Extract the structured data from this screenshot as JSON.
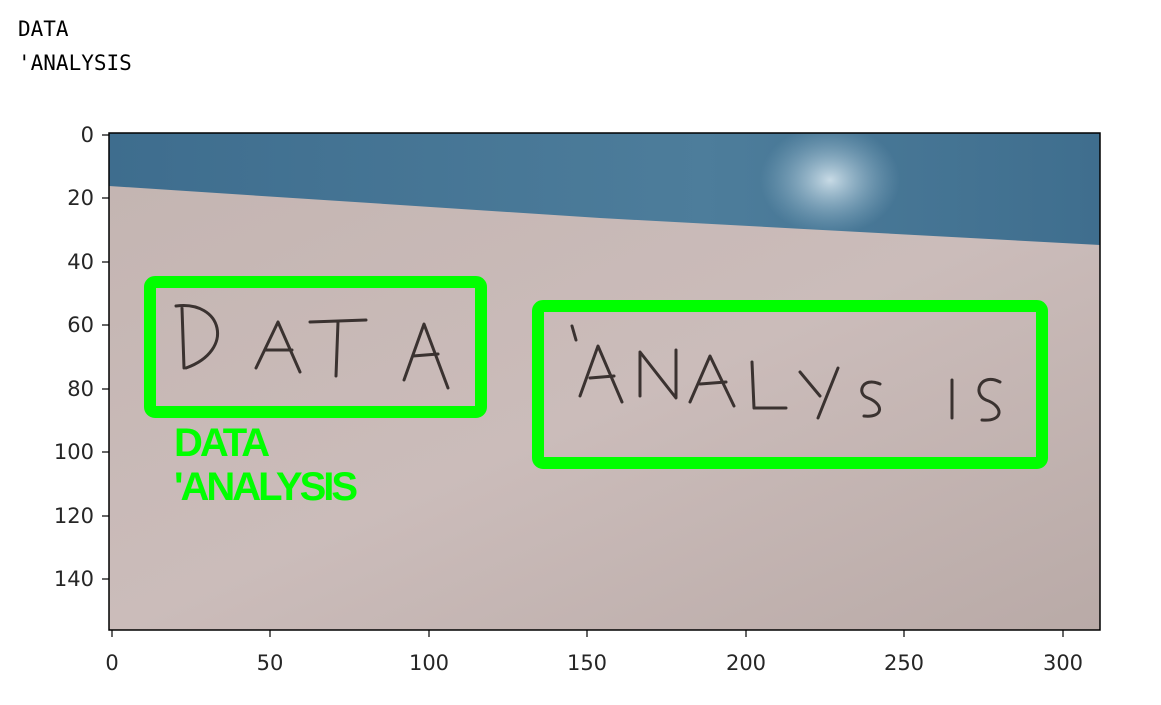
{
  "printed_output": {
    "lines": [
      "DATA",
      "'ANALYSIS"
    ]
  },
  "image_axes": {
    "x_ticks": [
      "0",
      "50",
      "100",
      "150",
      "200",
      "250",
      "300"
    ],
    "y_ticks": [
      "0",
      "20",
      "40",
      "60",
      "80",
      "100",
      "120",
      "140"
    ]
  },
  "photo": {
    "handwritten_words": [
      "DATA",
      "'ANALYSIS"
    ],
    "detections": [
      {
        "label": "DATA",
        "color": "#00ff00"
      },
      {
        "label": "'ANALYSIS",
        "color": "#00ff00"
      }
    ],
    "overlay_text": {
      "lines": [
        "DATA",
        "'ANALYSIS"
      ],
      "color": "#00ff00"
    }
  }
}
